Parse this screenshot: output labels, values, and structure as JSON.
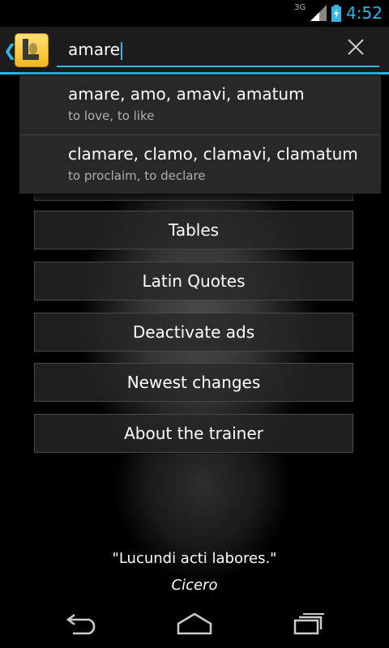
{
  "status": {
    "network": "3G",
    "time": "4:52"
  },
  "actionbar": {
    "search_query": "amare"
  },
  "suggestions": [
    {
      "main": "amare, amo, amavi, amatum",
      "sub": "to love, to like"
    },
    {
      "main": "clamare, clamo, clamavi, clamatum",
      "sub": "to proclaim, to declare"
    }
  ],
  "menu": {
    "items": [
      {
        "label": "Tables"
      },
      {
        "label": "Latin Quotes"
      },
      {
        "label": "Deactivate ads"
      },
      {
        "label": "Newest changes"
      },
      {
        "label": "About the trainer"
      }
    ]
  },
  "quote": {
    "text": "\"Lucundi acti labores.\"",
    "author": "Cicero"
  },
  "colors": {
    "accent": "#33b5e5",
    "background": "#000000",
    "dropdown": "#282828"
  },
  "icons": [
    "signal-icon",
    "battery-icon",
    "app-logo-icon",
    "clear-icon",
    "back-icon",
    "home-icon",
    "recent-apps-icon"
  ]
}
